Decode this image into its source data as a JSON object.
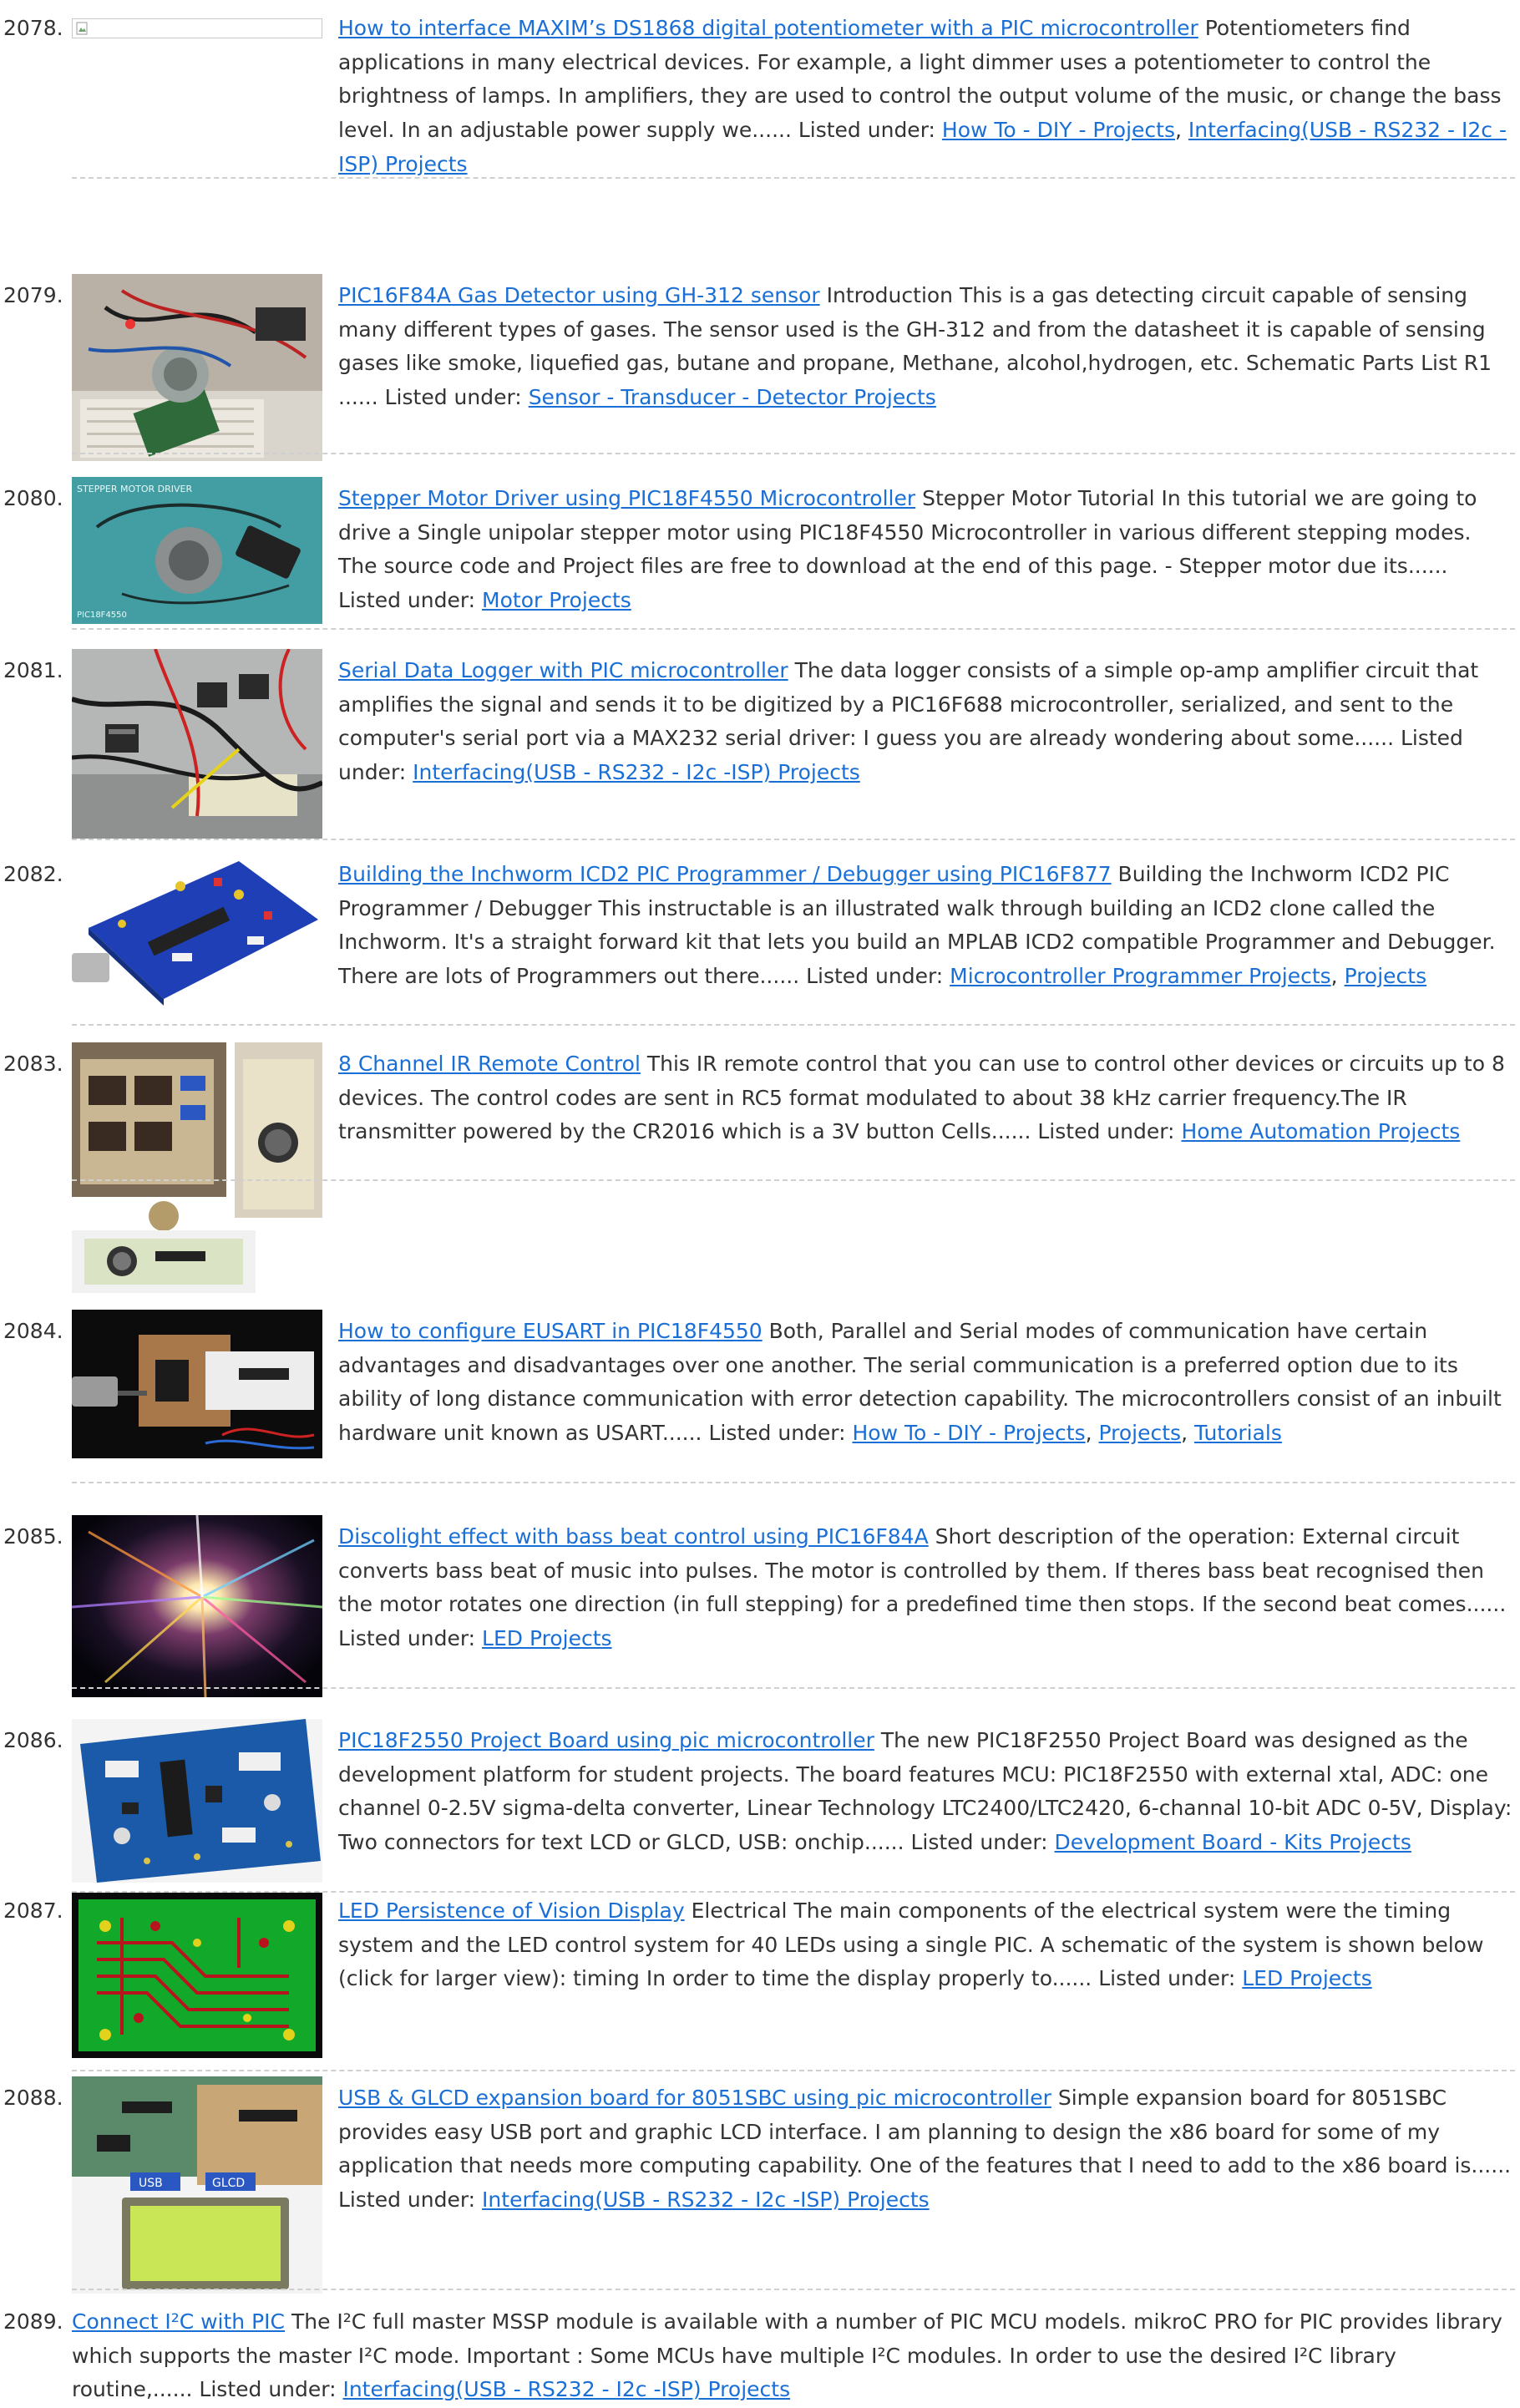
{
  "items": [
    {
      "number": "2078.",
      "title": "How to interface MAXIM’s DS1868 digital potentiometer with a PIC microcontroller",
      "description": " Potentiometers find applications in many electrical devices. For example, a light dimmer uses a potentiometer to control the brightness of lamps. In amplifiers, they are used to control the output volume of the music, or change the bass level. In an adjustable power supply we...... Listed under: ",
      "categories": [
        "How To - DIY - Projects",
        "Interfacing(USB - RS232 - I2c -ISP) Projects"
      ]
    },
    {
      "number": "2079.",
      "title": "PIC16F84A Gas Detector using GH-312 sensor",
      "description": " Introduction This is a gas detecting circuit capable of sensing many different types of gases. The sensor used is the GH-312 and from the datasheet it is capable of sensing gases like smoke, liquefied gas, butane and propane, Methane, alcohol,hydrogen, etc. Schematic Parts List R1                 ...... Listed under: ",
      "categories": [
        "Sensor - Transducer - Detector Projects"
      ]
    },
    {
      "number": "2080.",
      "title": "Stepper Motor Driver using PIC18F4550 Microcontroller",
      "description": " Stepper Motor Tutorial In this tutorial we are going to drive a Single unipolar stepper motor using PIC18F4550 Microcontroller in various different stepping modes. The source code and Project files are free to download at the end of this page. - Stepper motor due its...... Listed under: ",
      "categories": [
        "Motor Projects"
      ]
    },
    {
      "number": "2081.",
      "title": "Serial Data Logger with PIC microcontroller",
      "description": " The data logger consists of a simple op-amp amplifier circuit that amplifies the signal and sends it to be digitized by a PIC16F688 microcontroller, serialized, and sent to the computer's serial port via a MAX232 serial driver: I guess you are already wondering about some...... Listed under: ",
      "categories": [
        "Interfacing(USB - RS232 - I2c -ISP) Projects"
      ]
    },
    {
      "number": "2082.",
      "title": "Building the Inchworm ICD2 PIC Programmer / Debugger using PIC16F877",
      "description": " Building the Inchworm ICD2 PIC Programmer / Debugger This instructable is an illustrated walk through building an ICD2 clone called the Inchworm. It's a straight forward kit that lets you build an MPLAB ICD2 compatible Programmer and Debugger. There are lots of Programmers out there...... Listed under: ",
      "categories": [
        "Microcontroller Programmer Projects",
        "Projects"
      ]
    },
    {
      "number": "2083.",
      "title": "8 Channel IR Remote Control",
      "description": " This IR remote control that you can use to control other devices or circuits up to 8 devices. The control codes are sent in RC5 format modulated to about 38 kHz carrier frequency.The IR transmitter powered by the CR2016 which is a 3V button Cells...... Listed under: ",
      "categories": [
        "Home Automation Projects"
      ]
    },
    {
      "number": "2084.",
      "title": "How to configure EUSART in PIC18F4550",
      "description": " Both, Parallel and Serial modes of communication have certain advantages and disadvantages over one another. The serial communication is a preferred option due to its ability of long distance communication with error detection capability. The microcontrollers consist of an inbuilt hardware unit known as USART...... Listed under: ",
      "categories": [
        "How To - DIY - Projects",
        "Projects",
        "Tutorials"
      ]
    },
    {
      "number": "2085.",
      "title": "Discolight effect with bass beat control using PIC16F84A",
      "description": " Short description of the operation: External circuit converts bass beat of music into pulses. The motor is controlled by them. If theres bass beat recognised then the motor rotates one direction (in full stepping) for a predefined time then stops. If the second beat comes...... Listed under: ",
      "categories": [
        "LED Projects"
      ]
    },
    {
      "number": "2086.",
      "title": "PIC18F2550 Project Board using pic microcontroller",
      "description": " The new PIC18F2550 Project Board was designed as the development platform for student projects. The board features MCU: PIC18F2550 with external xtal, ADC: one channel 0-2.5V sigma-delta converter, Linear Technology LTC2400/LTC2420, 6-channal 10-bit ADC 0-5V, Display: Two connectors for text LCD or GLCD, USB: onchip...... Listed under: ",
      "categories": [
        "Development Board - Kits Projects"
      ]
    },
    {
      "number": "2087.",
      "title": "LED Persistence of Vision Display",
      "description": " Electrical The main components of the electrical system were the timing system and the LED control system for 40 LEDs using a single PIC. A schematic of the system is shown below (click for larger view): timing In order to time the display properly to...... Listed under: ",
      "categories": [
        "LED Projects"
      ]
    },
    {
      "number": "2088.",
      "title": "USB & GLCD expansion board for 8051SBC using pic microcontroller",
      "description": " Simple expansion board for 8051SBC provides easy USB port and graphic LCD interface. I am planning to design the x86 board for some of my application that needs more computing capability. One of the features that I need to add to the x86 board is...... Listed under: ",
      "categories": [
        "Interfacing(USB - RS232 - I2c -ISP) Projects"
      ]
    },
    {
      "number": "2089.",
      "title": "Connect I²C with PIC",
      "description": " The I²C full master MSSP module is available with a number of PIC MCU models. mikroC PRO for PIC provides library which supports the master I²C mode.   Important : Some MCUs have multiple I²C modules. In order to use the desired I²C library routine,...... Listed under: ",
      "categories": [
        "Interfacing(USB - RS232 - I2c -ISP) Projects"
      ]
    }
  ],
  "thumb_text": {
    "stepper_caption": "STEPPER MOTOR DRIVER",
    "stepper_chip": "PIC18F4550",
    "glcd_usb": "USB",
    "glcd_label": "GLCD"
  }
}
